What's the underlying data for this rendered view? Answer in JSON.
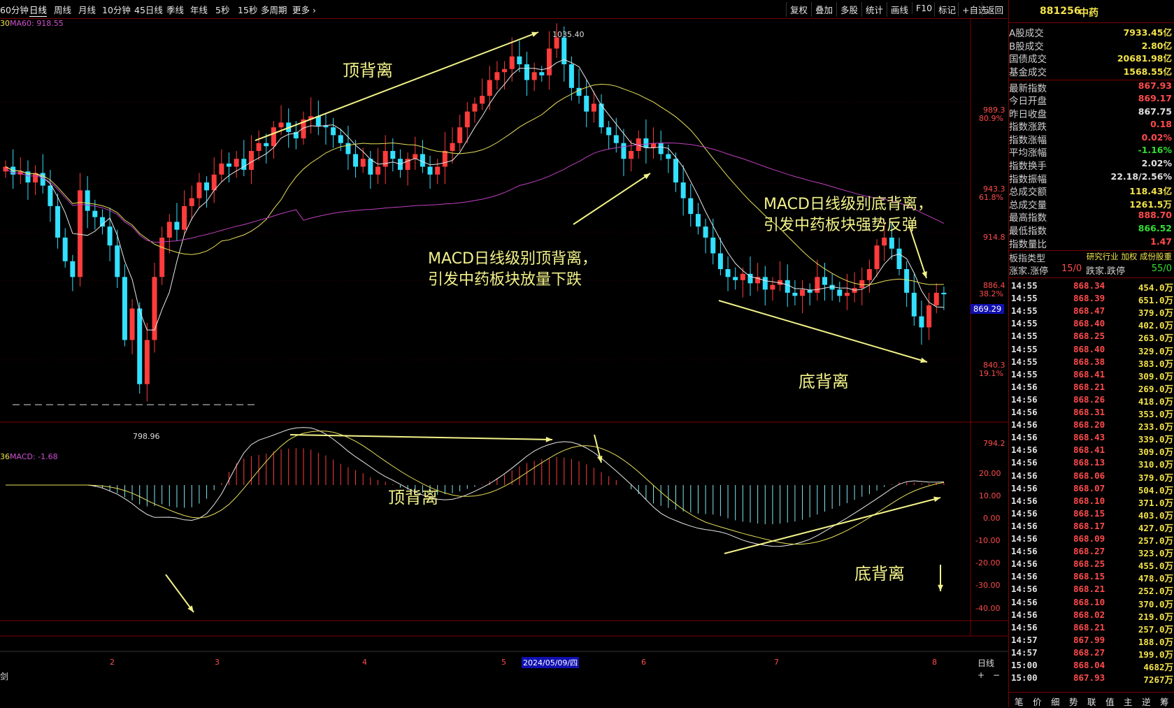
{
  "toolbar": {
    "periods": [
      "60分钟",
      "日线",
      "周线",
      "月线",
      "10分钟",
      "45日线",
      "季线",
      "年线",
      "5秒",
      "15秒",
      "多周期",
      "更多"
    ],
    "active_period": "日线",
    "tools": [
      "复权",
      "叠加",
      "多股",
      "统计",
      "画线",
      "F10",
      "标记",
      "+自选",
      "返回"
    ]
  },
  "chart": {
    "ma_label": "MA60: 918.55",
    "ma_label_prefix": "30",
    "macd_label_prefix": "36",
    "macd_label": "MACD: -1.68",
    "high_label": "1035.40",
    "low_label": "798.96",
    "current_price_tag": "869.29",
    "price_axis": [
      {
        "value": "989.3",
        "pct": "80.9%"
      },
      {
        "value": "943.3",
        "pct": "61.8%"
      },
      {
        "value": "914.8",
        "pct": ""
      },
      {
        "value": "886.4",
        "pct": "38.2%"
      },
      {
        "value": "840.3",
        "pct": "19.1%"
      },
      {
        "value": "794.2",
        "pct": ""
      }
    ],
    "macd_axis": [
      "20.00",
      "10.00",
      "0.00",
      "-10.00",
      "-20.00",
      "-30.00",
      "-40.00"
    ],
    "x_axis": [
      "2",
      "3",
      "4",
      "5",
      "6",
      "7",
      "8"
    ],
    "date_marker": "2024/05/09/四",
    "period_tag": "日线",
    "bottom_left": "剑",
    "scroll_buttons": [
      "+",
      "−"
    ]
  },
  "annotations": {
    "top_divergence": "顶背离",
    "top_divergence_macd": "顶背离",
    "macd_top_line1": "MACD日线级别顶背离，",
    "macd_top_line2": "引发中药板块放量下跌",
    "macd_bottom_line1": "MACD日线级别底背离，",
    "macd_bottom_line2": "引发中药板块强势反弹",
    "bottom_divergence": "底背离",
    "bottom_divergence_macd": "底背离"
  },
  "panel": {
    "code": "881256",
    "name": "中药",
    "stats": [
      {
        "label": "A股成交",
        "value": "7933.45亿",
        "color": "#f2e24b"
      },
      {
        "label": "B股成交",
        "value": "2.80亿",
        "color": "#f2e24b"
      },
      {
        "label": "国债成交",
        "value": "20681.98亿",
        "color": "#f2e24b"
      },
      {
        "label": "基金成交",
        "value": "1568.55亿",
        "color": "#f2e24b"
      },
      {
        "label": "最新指数",
        "value": "867.93",
        "color": "#ff4b4b"
      },
      {
        "label": "今日开盘",
        "value": "869.17",
        "color": "#ff4b4b"
      },
      {
        "label": "昨日收盘",
        "value": "867.75",
        "color": "#e0e0e0"
      },
      {
        "label": "指数涨跌",
        "value": "0.18",
        "color": "#ff4b4b"
      },
      {
        "label": "指数涨幅",
        "value": "0.02%",
        "color": "#ff4b4b"
      },
      {
        "label": "平均涨幅",
        "value": "-1.16%",
        "color": "#33dd33"
      },
      {
        "label": "指数换手",
        "value": "2.02%",
        "color": "#e0e0e0"
      },
      {
        "label": "指数振幅",
        "value": "22.18/2.56%",
        "color": "#e0e0e0"
      },
      {
        "label": "总成交额",
        "value": "118.43亿",
        "color": "#f2e24b"
      },
      {
        "label": "总成交量",
        "value": "1261.5万",
        "color": "#f2e24b"
      },
      {
        "label": "最高指数",
        "value": "888.70",
        "color": "#ff4b4b"
      },
      {
        "label": "最低指数",
        "value": "866.52",
        "color": "#33dd33"
      },
      {
        "label": "指数量比",
        "value": "1.47",
        "color": "#ff4b4b"
      }
    ],
    "board_type_label": "板指类型",
    "board_type_value": "研究行业 加权 成份股重",
    "rise_label": "涨家.涨停",
    "rise_value": "15/0",
    "fall_label": "跌家.跌停",
    "fall_value": "55/0",
    "ticks": [
      {
        "time": "14:55",
        "price": "868.34",
        "vol": "454.0万"
      },
      {
        "time": "14:55",
        "price": "868.39",
        "vol": "651.0万"
      },
      {
        "time": "14:55",
        "price": "868.47",
        "vol": "379.0万"
      },
      {
        "time": "14:55",
        "price": "868.40",
        "vol": "402.0万"
      },
      {
        "time": "14:55",
        "price": "868.25",
        "vol": "263.0万"
      },
      {
        "time": "14:55",
        "price": "868.40",
        "vol": "329.0万"
      },
      {
        "time": "14:55",
        "price": "868.38",
        "vol": "383.0万"
      },
      {
        "time": "14:55",
        "price": "868.41",
        "vol": "309.0万"
      },
      {
        "time": "14:56",
        "price": "868.21",
        "vol": "269.0万"
      },
      {
        "time": "14:56",
        "price": "868.26",
        "vol": "418.0万"
      },
      {
        "time": "14:56",
        "price": "868.31",
        "vol": "353.0万"
      },
      {
        "time": "14:56",
        "price": "868.20",
        "vol": "233.0万"
      },
      {
        "time": "14:56",
        "price": "868.43",
        "vol": "339.0万"
      },
      {
        "time": "14:56",
        "price": "868.41",
        "vol": "309.0万"
      },
      {
        "time": "14:56",
        "price": "868.13",
        "vol": "310.0万"
      },
      {
        "time": "14:56",
        "price": "868.06",
        "vol": "379.0万"
      },
      {
        "time": "14:56",
        "price": "868.07",
        "vol": "504.0万"
      },
      {
        "time": "14:56",
        "price": "868.10",
        "vol": "371.0万"
      },
      {
        "time": "14:56",
        "price": "868.15",
        "vol": "403.0万"
      },
      {
        "time": "14:56",
        "price": "868.17",
        "vol": "427.0万"
      },
      {
        "time": "14:56",
        "price": "868.09",
        "vol": "257.0万"
      },
      {
        "time": "14:56",
        "price": "868.27",
        "vol": "323.0万"
      },
      {
        "time": "14:56",
        "price": "868.25",
        "vol": "455.0万"
      },
      {
        "time": "14:56",
        "price": "868.15",
        "vol": "478.0万"
      },
      {
        "time": "14:56",
        "price": "868.21",
        "vol": "252.0万"
      },
      {
        "time": "14:56",
        "price": "868.10",
        "vol": "370.0万"
      },
      {
        "time": "14:56",
        "price": "868.02",
        "vol": "219.0万"
      },
      {
        "time": "14:56",
        "price": "868.21",
        "vol": "257.0万"
      },
      {
        "time": "14:57",
        "price": "867.99",
        "vol": "188.0万"
      },
      {
        "time": "14:57",
        "price": "868.27",
        "vol": "199.0万"
      },
      {
        "time": "15:00",
        "price": "868.04",
        "vol": "4682万"
      },
      {
        "time": "15:00",
        "price": "867.93",
        "vol": "7267万"
      }
    ],
    "tabs": [
      "笔",
      "价",
      "细",
      "势",
      "联",
      "值",
      "主",
      "逆",
      "筹"
    ]
  },
  "colors": {
    "up": "#ff3c3c",
    "down": "#33e0ff",
    "annotation": "#f2f28a",
    "ma_purple": "#c040c0",
    "grid_red": "#7a0000"
  }
}
